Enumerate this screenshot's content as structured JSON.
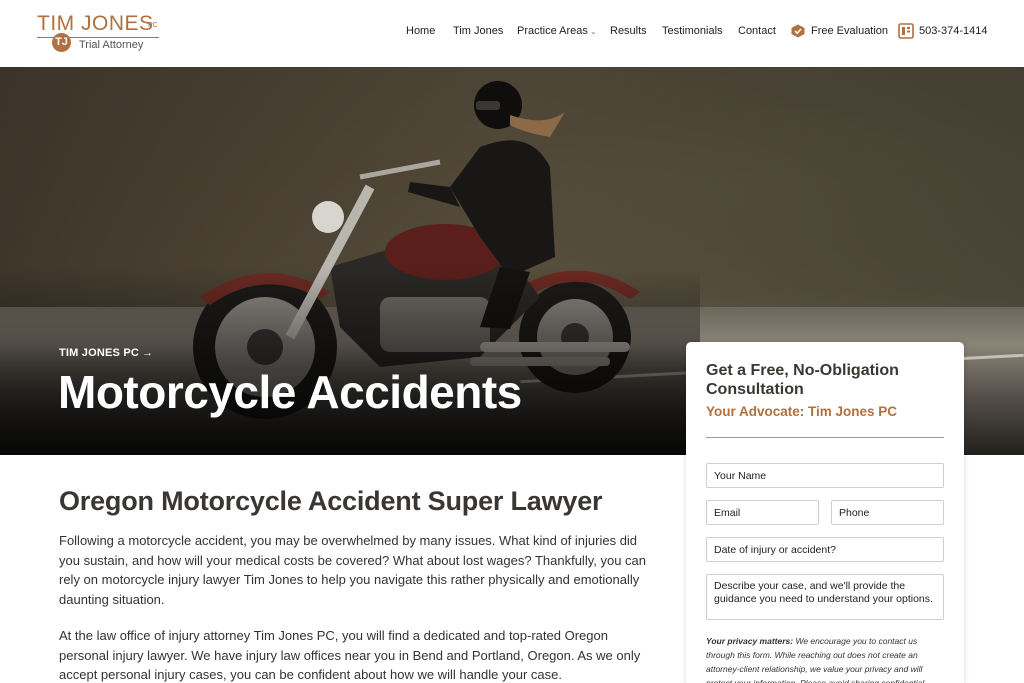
{
  "logo": {
    "name": "TIM JONES",
    "suffix": "PC",
    "monogram": "TJ",
    "tagline": "Trial Attorney"
  },
  "nav": {
    "items": [
      {
        "label": "Home"
      },
      {
        "label": "Tim Jones"
      },
      {
        "label": "Practice Areas",
        "has_dropdown": true
      },
      {
        "label": "Results"
      },
      {
        "label": "Testimonials"
      },
      {
        "label": "Contact"
      }
    ],
    "evaluation_label": "Free Evaluation",
    "evaluation_icon": "checkmark-badge-icon",
    "phone_label": "503-374-1414",
    "phone_icon": "phone-book-icon",
    "accent_color": "#b0703f"
  },
  "hero": {
    "breadcrumb": "TIM JONES PC",
    "breadcrumb_icon": "arrow-right-icon",
    "title": "Motorcycle Accidents"
  },
  "main": {
    "heading": "Oregon Motorcycle Accident Super Lawyer",
    "paragraphs": [
      "Following a motorcycle accident, you may be overwhelmed by many issues. What kind of injuries did you sustain, and how will your medical costs be covered? What about lost wages? Thankfully, you can rely on motorcycle injury lawyer Tim Jones to help you navigate this rather physically and emotionally daunting situation.",
      "At the law office of injury attorney Tim Jones PC, you will find a dedicated and top-rated Oregon personal injury lawyer. We have injury law offices near you in Bend and Portland, Oregon. As we only accept personal injury cases, you can be confident about how we will handle your case."
    ]
  },
  "form": {
    "title": "Get a Free, No-Obligation Consultation",
    "subtitle": "Your Advocate: Tim Jones PC",
    "name_placeholder": "Your Name",
    "email_placeholder": "Email",
    "phone_placeholder": "Phone",
    "date_placeholder": "Date of injury or accident?",
    "case_placeholder": "Describe your case, and we'll provide the guidance you need to understand your options.",
    "privacy_label": "Your privacy matters:",
    "privacy_text": "We encourage you to contact us through this form. While reaching out does not create an attorney-client relationship, we value your privacy and will protect your information. Please avoid sharing confidential"
  }
}
